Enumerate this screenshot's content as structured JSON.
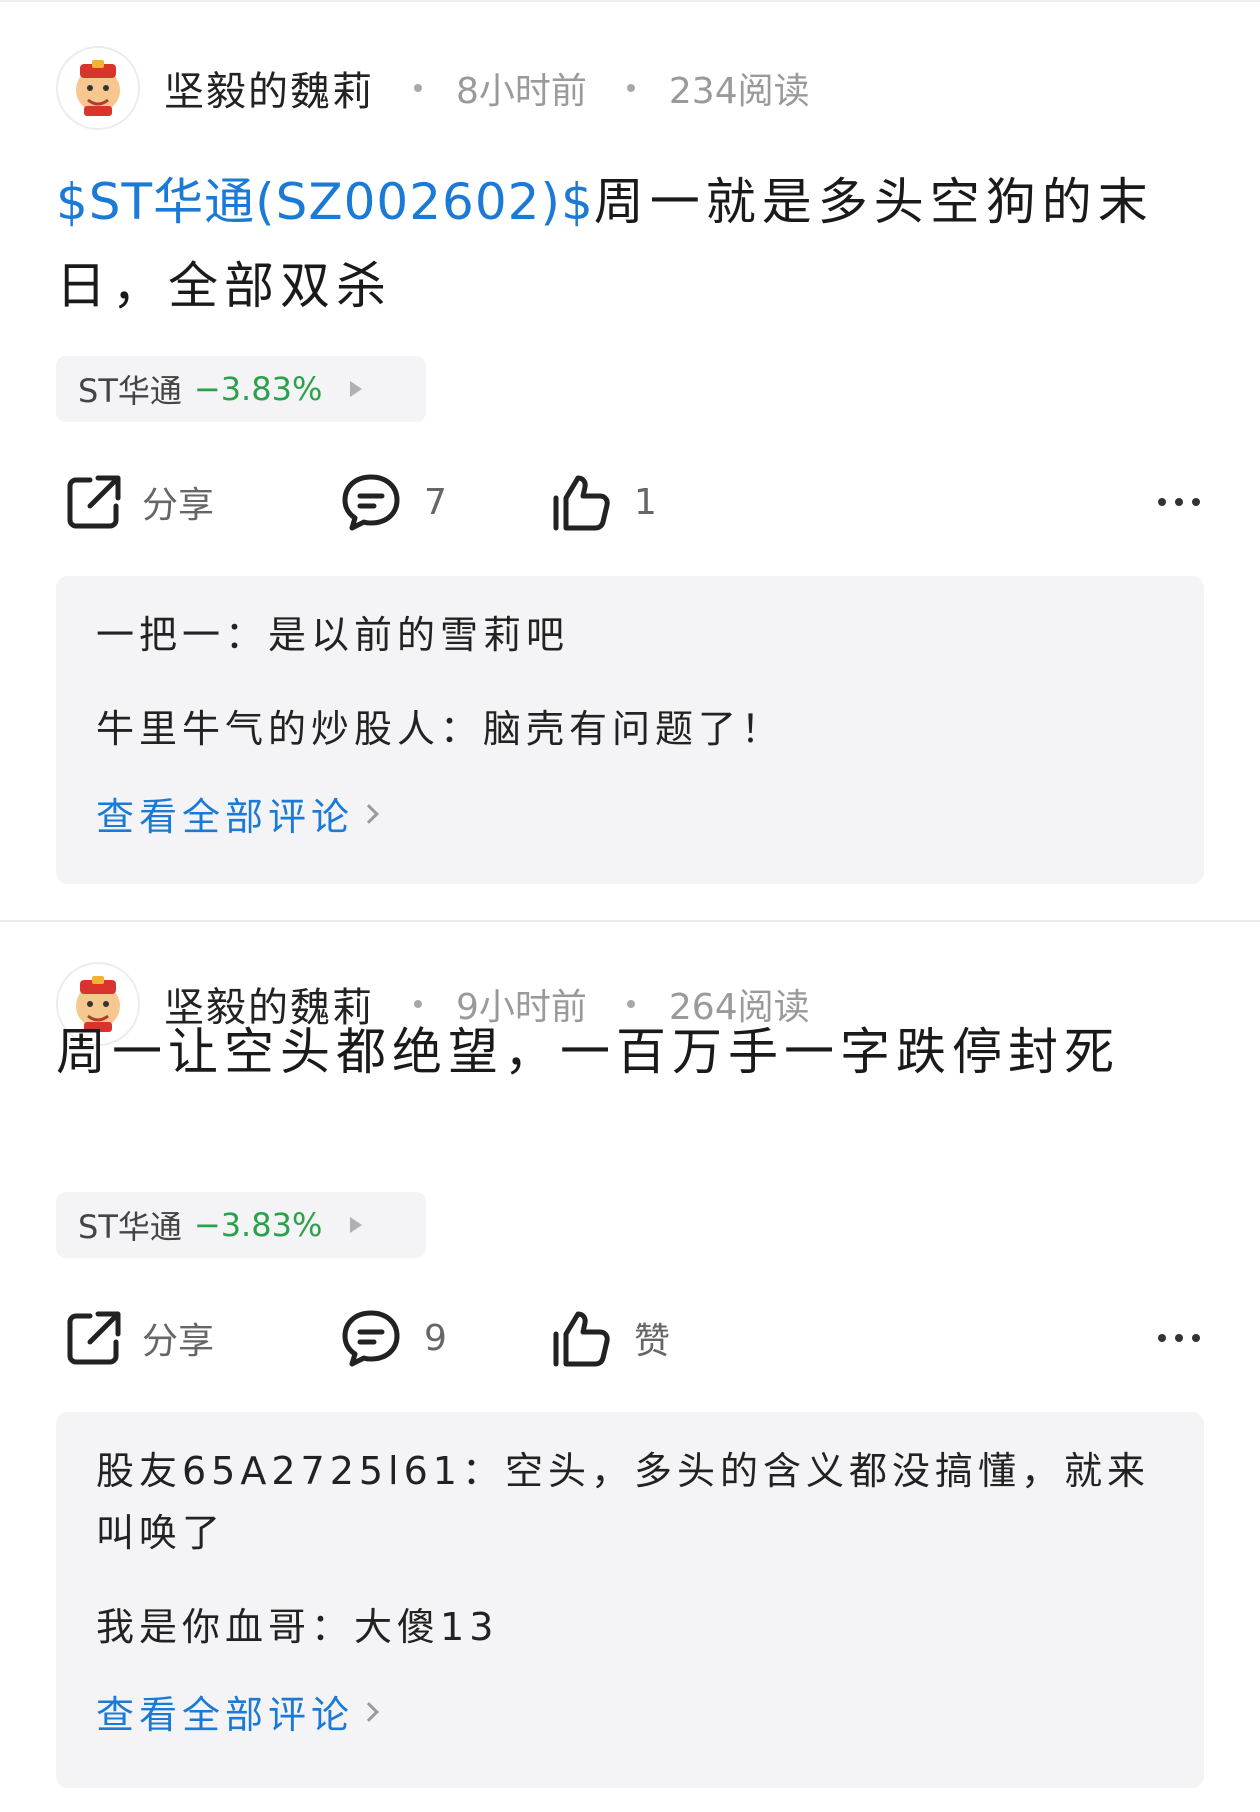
{
  "posts": [
    {
      "author": "坚毅的魏莉",
      "time": "8小时前",
      "reads": "234阅读",
      "tag": "$ST华通(SZ002602)$",
      "text": "周一就是多头空狗的末日，全部双杀",
      "stock": {
        "name": "ST华通",
        "change": "−3.83%"
      },
      "actions": {
        "share": "分享",
        "comments": "7",
        "likes": "1"
      },
      "comments": [
        {
          "author": "一把一",
          "sep": "：",
          "text": "是以前的雪莉吧"
        },
        {
          "author": "牛里牛气的炒股人",
          "sep": "：",
          "text": "脑壳有问题了！"
        }
      ],
      "view_all": "查看全部评论"
    },
    {
      "author": "坚毅的魏莉",
      "time": "9小时前",
      "reads": "264阅读",
      "tag": "",
      "text": "周一让空头都绝望，一百万手一字跌停封死",
      "stock": {
        "name": "ST华通",
        "change": "−3.83%"
      },
      "actions": {
        "share": "分享",
        "comments": "9",
        "likes": "赞"
      },
      "comments": [
        {
          "author": "股友65A2725l61",
          "sep": "：",
          "text": "空头，多头的含义都没搞懂，就来叫唤了"
        },
        {
          "author": "我是你血哥",
          "sep": "：",
          "text": "大傻13"
        }
      ],
      "view_all": "查看全部评论"
    }
  ],
  "colors": {
    "link": "#1b7ad6",
    "down": "#2aa14a",
    "panel": "#f4f4f6"
  },
  "icons": [
    "share-icon",
    "comment-icon",
    "like-icon",
    "more-icon",
    "chevron-right-icon"
  ]
}
